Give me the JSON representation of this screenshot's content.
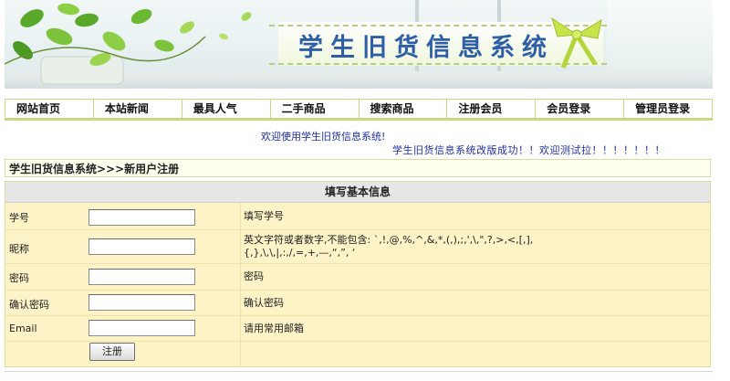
{
  "banner": {
    "title": "学生旧货信息系统"
  },
  "nav": {
    "items": [
      {
        "label": "网站首页"
      },
      {
        "label": "本站新闻"
      },
      {
        "label": "最具人气"
      },
      {
        "label": "二手商品"
      },
      {
        "label": "搜索商品"
      },
      {
        "label": "注册会员"
      },
      {
        "label": "会员登录"
      },
      {
        "label": "管理员登录"
      }
    ]
  },
  "marquee": {
    "welcome": "欢迎使用学生旧货信息系统!",
    "notice": "学生旧货信息系统改版成功！！欢迎测试拉！！！！！！！"
  },
  "breadcrumb": "学生旧货信息系统>>>新用户注册",
  "form": {
    "heading": "填写基本信息",
    "fields": [
      {
        "label": "学号",
        "value": "",
        "hint": "填写学号"
      },
      {
        "label": "昵称",
        "value": "",
        "hint": "英文字符或者数字,不能包含: `,!,@,%,^,&,*,(,),;,',\\,\",?,>,<,[,],{,},\\,\\,|,:,/,=,+,—,“,”, ‘"
      },
      {
        "label": "密码",
        "value": "",
        "hint": "密码"
      },
      {
        "label": "确认密码",
        "value": "",
        "hint": "确认密码"
      },
      {
        "label": "Email",
        "value": "",
        "hint": "请用常用邮箱"
      }
    ],
    "submit_label": "注册"
  }
}
